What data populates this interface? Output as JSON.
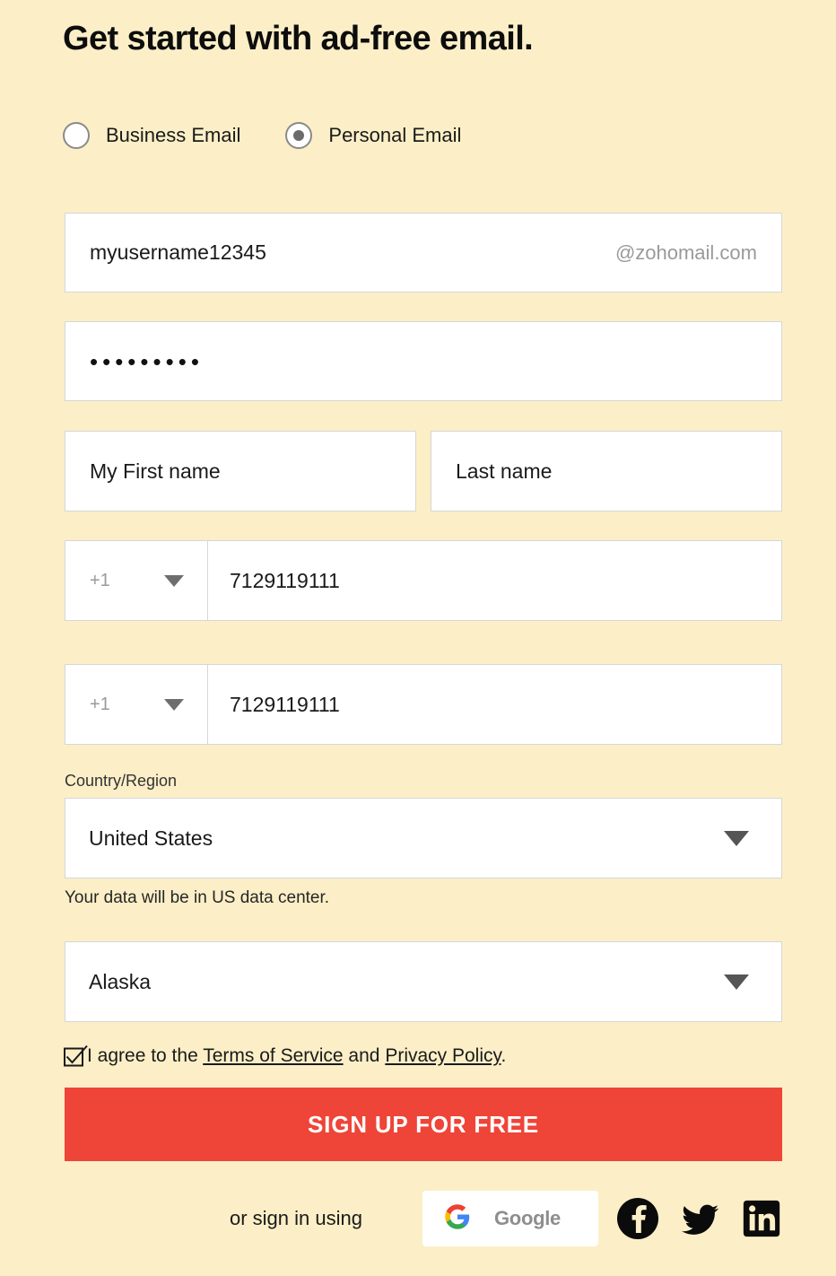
{
  "heading": "Get started with ad-free email.",
  "account_type": {
    "options": [
      {
        "label": "Business Email",
        "selected": false
      },
      {
        "label": "Personal Email",
        "selected": true
      }
    ]
  },
  "form": {
    "username": {
      "value": "myusername12345",
      "domain_suffix": "@zohomail.com"
    },
    "password": {
      "masked_value": "•••••••••",
      "character_count": 9
    },
    "first_name": {
      "value": "My First name"
    },
    "last_name": {
      "value": "Last name"
    },
    "phone_primary": {
      "country_code": "+1",
      "number": "7129119111"
    },
    "phone_secondary": {
      "country_code": "+1",
      "number": "7129119111"
    },
    "country": {
      "label": "Country/Region",
      "value": "United States",
      "note": "Your data will be in US data center."
    },
    "state": {
      "value": "Alaska"
    },
    "terms": {
      "checked": true,
      "text_before": "I agree to the ",
      "terms_link": "Terms of Service",
      "text_middle": " and ",
      "privacy_link": "Privacy Policy",
      "text_after": "."
    }
  },
  "submit": {
    "label": "SIGN UP FOR FREE"
  },
  "social": {
    "prefix": "or sign in using",
    "google_label": "Google",
    "providers": [
      "google",
      "facebook",
      "twitter",
      "linkedin"
    ]
  },
  "colors": {
    "page_background": "#FCEFC7",
    "submit_background": "#EF4438",
    "submit_text": "#FFFFFF",
    "field_background": "#FFFFFF",
    "field_border": "#D6D6D6",
    "muted_text": "#9A9A9A",
    "google_blue": "#4285F4",
    "google_red": "#EA4335",
    "google_yellow": "#FBBC05",
    "google_green": "#34A853"
  }
}
